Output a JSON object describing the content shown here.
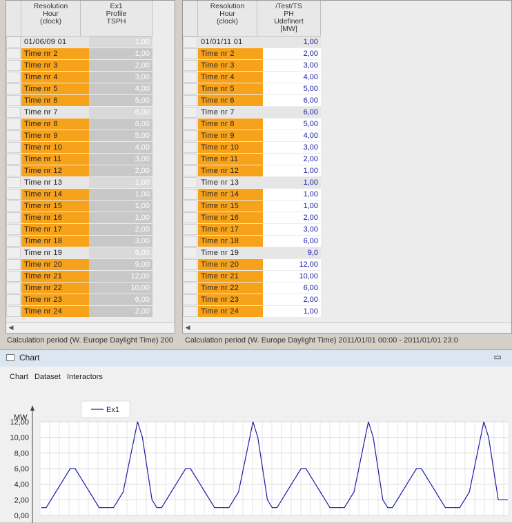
{
  "left_table": {
    "headers": [
      "Resolution\nHour\n(clock)",
      "Ex1\nProfile\nTSPH"
    ],
    "rows": [
      {
        "time": "01/06/09  01",
        "value": "1,00",
        "highlight": false
      },
      {
        "time": "Time  nr   2",
        "value": "1,00",
        "highlight": true
      },
      {
        "time": "Time  nr   3",
        "value": "2,00",
        "highlight": true
      },
      {
        "time": "Time  nr   4",
        "value": "3,00",
        "highlight": true
      },
      {
        "time": "Time  nr   5",
        "value": "4,00",
        "highlight": true
      },
      {
        "time": "Time  nr   6",
        "value": "5,00",
        "highlight": true
      },
      {
        "time": "Time  nr   7",
        "value": "6,00",
        "highlight": false
      },
      {
        "time": "Time  nr   8",
        "value": "6,00",
        "highlight": true
      },
      {
        "time": "Time  nr   9",
        "value": "5,00",
        "highlight": true
      },
      {
        "time": "Time  nr  10",
        "value": "4,00",
        "highlight": true
      },
      {
        "time": "Time  nr  11",
        "value": "3,00",
        "highlight": true
      },
      {
        "time": "Time  nr  12",
        "value": "2,00",
        "highlight": true
      },
      {
        "time": "Time  nr  13",
        "value": "1,00",
        "highlight": false
      },
      {
        "time": "Time  nr  14",
        "value": "1,00",
        "highlight": true
      },
      {
        "time": "Time  nr  15",
        "value": "1,00",
        "highlight": true
      },
      {
        "time": "Time  nr  16",
        "value": "1,00",
        "highlight": true
      },
      {
        "time": "Time  nr  17",
        "value": "2,00",
        "highlight": true
      },
      {
        "time": "Time  nr  18",
        "value": "3,00",
        "highlight": true
      },
      {
        "time": "Time  nr  19",
        "value": "6,00",
        "highlight": false
      },
      {
        "time": "Time  nr  20",
        "value": "9,00",
        "highlight": true
      },
      {
        "time": "Time  nr  21",
        "value": "12,00",
        "highlight": true
      },
      {
        "time": "Time  nr  22",
        "value": "10,00",
        "highlight": true
      },
      {
        "time": "Time  nr  23",
        "value": "6,00",
        "highlight": true
      },
      {
        "time": "Time  nr  24",
        "value": "2,00",
        "highlight": true
      }
    ]
  },
  "right_table": {
    "headers": [
      "Resolution\nHour\n(clock)",
      "/Test/TS\nPH\nUdefinert\n[MW]"
    ],
    "rows": [
      {
        "time": "01/01/11  01",
        "value": "1,00",
        "highlight": false
      },
      {
        "time": "Time  nr   2",
        "value": "2,00",
        "highlight": true
      },
      {
        "time": "Time  nr   3",
        "value": "3,00",
        "highlight": true
      },
      {
        "time": "Time  nr   4",
        "value": "4,00",
        "highlight": true
      },
      {
        "time": "Time  nr   5",
        "value": "5,00",
        "highlight": true
      },
      {
        "time": "Time  nr   6",
        "value": "6,00",
        "highlight": true
      },
      {
        "time": "Time  nr   7",
        "value": "6,00",
        "highlight": false
      },
      {
        "time": "Time  nr   8",
        "value": "5,00",
        "highlight": true
      },
      {
        "time": "Time  nr   9",
        "value": "4,00",
        "highlight": true
      },
      {
        "time": "Time  nr  10",
        "value": "3,00",
        "highlight": true
      },
      {
        "time": "Time  nr  11",
        "value": "2,00",
        "highlight": true
      },
      {
        "time": "Time  nr  12",
        "value": "1,00",
        "highlight": true
      },
      {
        "time": "Time  nr  13",
        "value": "1,00",
        "highlight": false
      },
      {
        "time": "Time  nr  14",
        "value": "1,00",
        "highlight": true
      },
      {
        "time": "Time  nr  15",
        "value": "1,00",
        "highlight": true
      },
      {
        "time": "Time  nr  16",
        "value": "2,00",
        "highlight": true
      },
      {
        "time": "Time  nr  17",
        "value": "3,00",
        "highlight": true
      },
      {
        "time": "Time  nr  18",
        "value": "6,00",
        "highlight": true
      },
      {
        "time": "Time  nr  19",
        "value": "9,0",
        "highlight": false
      },
      {
        "time": "Time  nr  20",
        "value": "12,00",
        "highlight": true
      },
      {
        "time": "Time  nr  21",
        "value": "10,00",
        "highlight": true
      },
      {
        "time": "Time  nr  22",
        "value": "6,00",
        "highlight": true
      },
      {
        "time": "Time  nr  23",
        "value": "2,00",
        "highlight": true
      },
      {
        "time": "Time  nr  24",
        "value": "1,00",
        "highlight": true
      }
    ]
  },
  "status": {
    "left": "Calculation period    (W. Europe Daylight Time) 200",
    "right": "Calculation period    (W. Europe Daylight Time) 2011/01/01 00:00 - 2011/01/01 23:0"
  },
  "colors": {
    "highlight": "#f7a21b",
    "series": "#1a1aa8"
  },
  "chart_window": {
    "title": "Chart",
    "menu": [
      "Chart",
      "Dataset",
      "Interactors"
    ]
  },
  "chart_data": {
    "type": "line",
    "ylabel": "MW",
    "ylim": [
      0,
      12
    ],
    "yticks": [
      "0,00",
      "2,00",
      "4,00",
      "6,00",
      "8,00",
      "10,00",
      "12,00"
    ],
    "grid": true,
    "legend": "top-left",
    "series": [
      {
        "name": "Ex1",
        "values": [
          1,
          1,
          2,
          3,
          4,
          5,
          6,
          6,
          5,
          4,
          3,
          2,
          1,
          1,
          1,
          1,
          2,
          3,
          6,
          9,
          12,
          10,
          6,
          2,
          1,
          1,
          2,
          3,
          4,
          5,
          6,
          6,
          5,
          4,
          3,
          2,
          1,
          1,
          1,
          1,
          2,
          3,
          6,
          9,
          12,
          10,
          6,
          2,
          1,
          1,
          2,
          3,
          4,
          5,
          6,
          6,
          5,
          4,
          3,
          2,
          1,
          1,
          1,
          1,
          2,
          3,
          6,
          9,
          12,
          10,
          6,
          2,
          1,
          1,
          2,
          3,
          4,
          5,
          6,
          6,
          5,
          4,
          3,
          2,
          1,
          1,
          1,
          1,
          2,
          3,
          6,
          9,
          12,
          10,
          6,
          2,
          2,
          2
        ]
      }
    ]
  }
}
